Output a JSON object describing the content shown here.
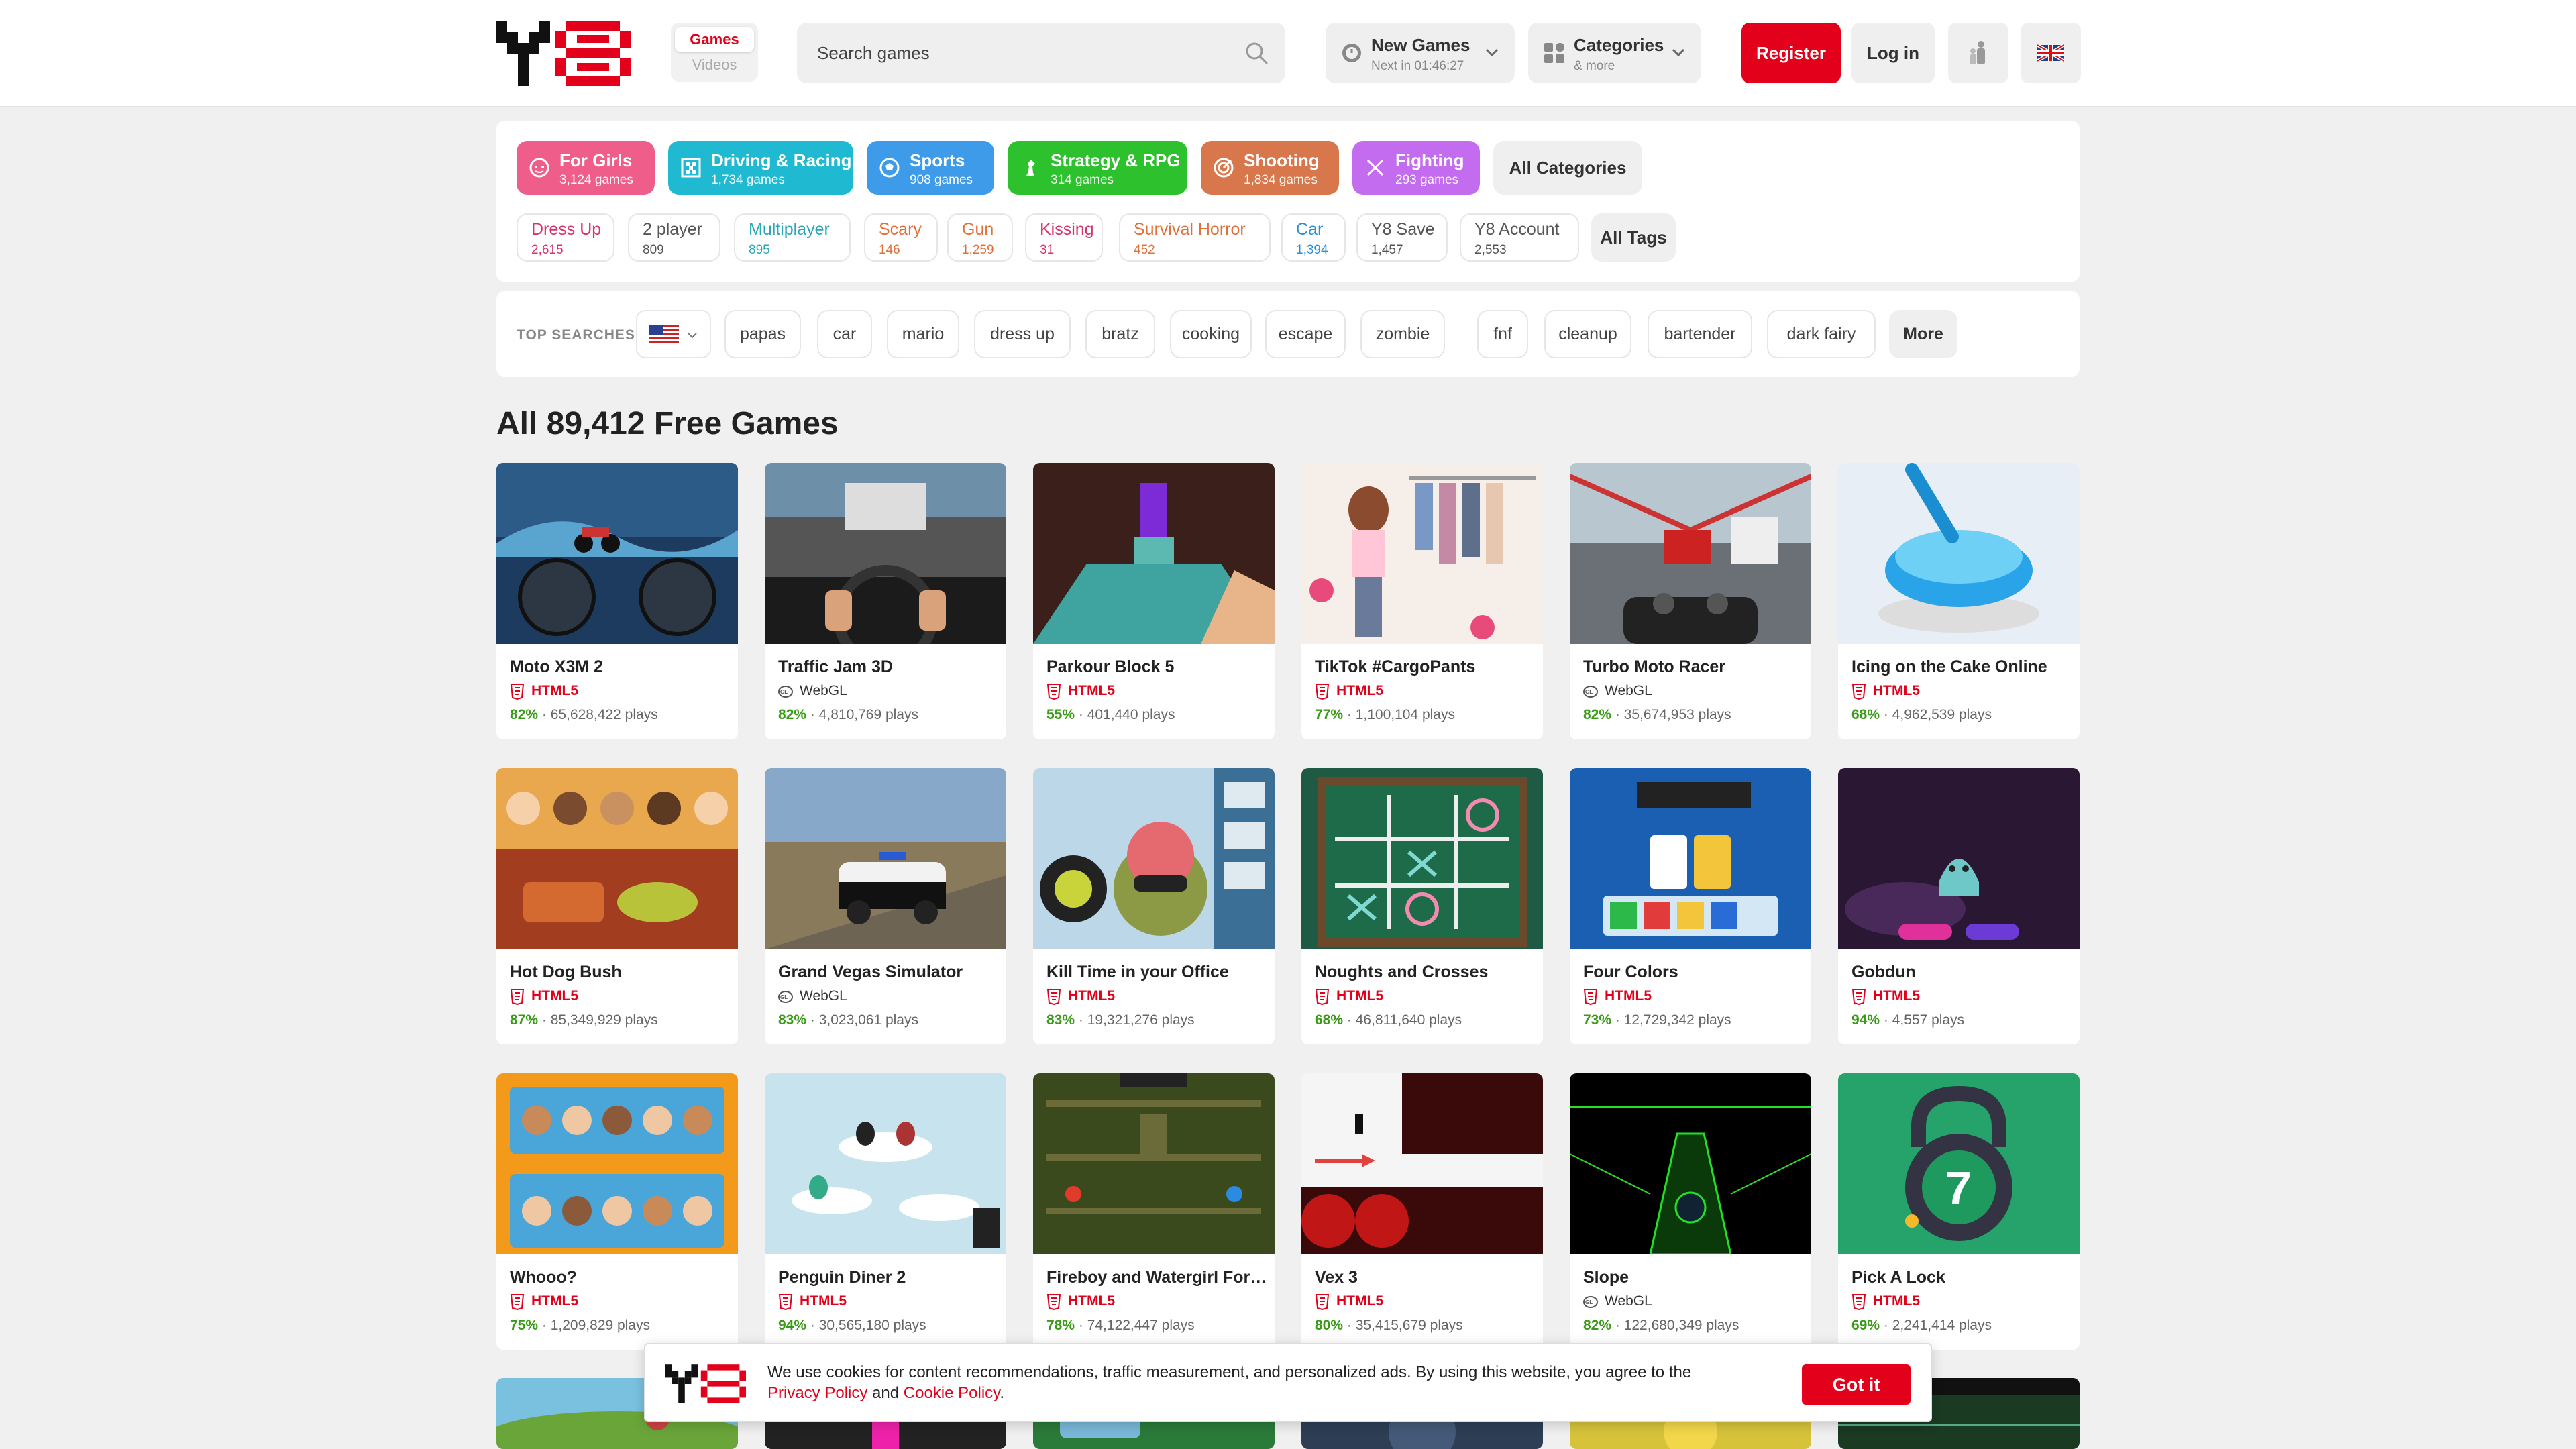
{
  "header": {
    "mode_games": "Games",
    "mode_videos": "Videos",
    "search_placeholder": "Search games",
    "new_games_title": "New Games",
    "new_games_sub": "Next in 01:46:27",
    "categories_title": "Categories",
    "categories_sub": "& more",
    "register": "Register",
    "login": "Log in"
  },
  "categories": [
    {
      "name": "For Girls",
      "count": "3,124 games",
      "color": "#ef5d8a"
    },
    {
      "name": "Driving & Racing",
      "count": "1,734 games",
      "color": "#1fb9d1"
    },
    {
      "name": "Sports",
      "count": "908 games",
      "color": "#3e9be9"
    },
    {
      "name": "Strategy & RPG",
      "count": "314 games",
      "color": "#2ec12e"
    },
    {
      "name": "Shooting",
      "count": "1,834 games",
      "color": "#d9774c"
    },
    {
      "name": "Fighting",
      "count": "293 games",
      "color": "#c46cf0"
    }
  ],
  "all_categories": "All Categories",
  "tags": [
    {
      "name": "Dress Up",
      "count": "2,615",
      "color": "#d9316c"
    },
    {
      "name": "2 player",
      "count": "809",
      "color": "#555555"
    },
    {
      "name": "Multiplayer",
      "count": "895",
      "color": "#2ba8b6"
    },
    {
      "name": "Scary",
      "count": "146",
      "color": "#e0703a"
    },
    {
      "name": "Gun",
      "count": "1,259",
      "color": "#e0703a"
    },
    {
      "name": "Kissing",
      "count": "31",
      "color": "#d9316c"
    },
    {
      "name": "Survival Horror",
      "count": "452",
      "color": "#e0703a"
    },
    {
      "name": "Car",
      "count": "1,394",
      "color": "#2b8fd6"
    },
    {
      "name": "Y8 Save",
      "count": "1,457",
      "color": "#555555"
    },
    {
      "name": "Y8 Account",
      "count": "2,553",
      "color": "#555555"
    }
  ],
  "all_tags": "All Tags",
  "top_searches_label": "TOP SEARCHES",
  "top_searches": [
    "papas",
    "car",
    "mario",
    "dress up",
    "bratz",
    "cooking",
    "escape",
    "zombie",
    "fnf",
    "cleanup",
    "bartender",
    "dark fairy"
  ],
  "more": "More",
  "section_title": "All 89,412 Free Games",
  "games": [
    {
      "title": "Moto X3M 2",
      "tech": "HTML5",
      "rating": "82%",
      "plays": "65,628,422 plays",
      "icon": "motorbike-thumbnail"
    },
    {
      "title": "Traffic Jam 3D",
      "tech": "WebGL",
      "rating": "82%",
      "plays": "4,810,769 plays",
      "icon": "car-interior-thumbnail"
    },
    {
      "title": "Parkour Block 5",
      "tech": "HTML5",
      "rating": "55%",
      "plays": "401,440 plays",
      "icon": "block-parkour-thumbnail"
    },
    {
      "title": "TikTok #CargoPants",
      "tech": "HTML5",
      "rating": "77%",
      "plays": "1,100,104 plays",
      "icon": "dressup-thumbnail"
    },
    {
      "title": "Turbo Moto Racer",
      "tech": "WebGL",
      "rating": "82%",
      "plays": "35,674,953 plays",
      "icon": "moto-racer-thumbnail"
    },
    {
      "title": "Icing on the Cake Online",
      "tech": "HTML5",
      "rating": "68%",
      "plays": "4,962,539 plays",
      "icon": "cake-thumbnail"
    },
    {
      "title": "Hot Dog Bush",
      "tech": "HTML5",
      "rating": "87%",
      "plays": "85,349,929 plays",
      "icon": "hotdog-thumbnail"
    },
    {
      "title": "Grand Vegas Simulator",
      "tech": "WebGL",
      "rating": "83%",
      "plays": "3,023,061 plays",
      "icon": "police-car-thumbnail"
    },
    {
      "title": "Kill Time in your Office",
      "tech": "HTML5",
      "rating": "83%",
      "plays": "19,321,276 plays",
      "icon": "office-thumbnail"
    },
    {
      "title": "Noughts and Crosses",
      "tech": "HTML5",
      "rating": "68%",
      "plays": "46,811,640 plays",
      "icon": "tictactoe-thumbnail"
    },
    {
      "title": "Four Colors",
      "tech": "HTML5",
      "rating": "73%",
      "plays": "12,729,342 plays",
      "icon": "cards-thumbnail"
    },
    {
      "title": "Gobdun",
      "tech": "HTML5",
      "rating": "94%",
      "plays": "4,557 plays",
      "icon": "ghost-thumbnail"
    },
    {
      "title": "Whooo?",
      "tech": "HTML5",
      "rating": "75%",
      "plays": "1,209,829 plays",
      "icon": "guess-who-thumbnail"
    },
    {
      "title": "Penguin Diner 2",
      "tech": "HTML5",
      "rating": "94%",
      "plays": "30,565,180 plays",
      "icon": "penguin-thumbnail"
    },
    {
      "title": "Fireboy and Watergirl Forest Temple",
      "tech": "HTML5",
      "rating": "78%",
      "plays": "74,122,447 plays",
      "icon": "temple-thumbnail"
    },
    {
      "title": "Vex 3",
      "tech": "HTML5",
      "rating": "80%",
      "plays": "35,415,679 plays",
      "icon": "vex-thumbnail"
    },
    {
      "title": "Slope",
      "tech": "WebGL",
      "rating": "82%",
      "plays": "122,680,349 plays",
      "icon": "slope-thumbnail"
    },
    {
      "title": "Pick A Lock",
      "tech": "HTML5",
      "rating": "69%",
      "plays": "2,241,414 plays",
      "icon": "lock-thumbnail"
    }
  ],
  "cookie": {
    "text": "We use cookies for content recommendations, traffic measurement, and personalized ads. By using this website, you agree to the ",
    "privacy": "Privacy Policy",
    "and": " and ",
    "cookie_policy": "Cookie Policy",
    "end": ".",
    "button": "Got it"
  },
  "colors": {
    "brand": "#e2001a",
    "rating": "#3a9b17",
    "html5": "#e2001a"
  }
}
